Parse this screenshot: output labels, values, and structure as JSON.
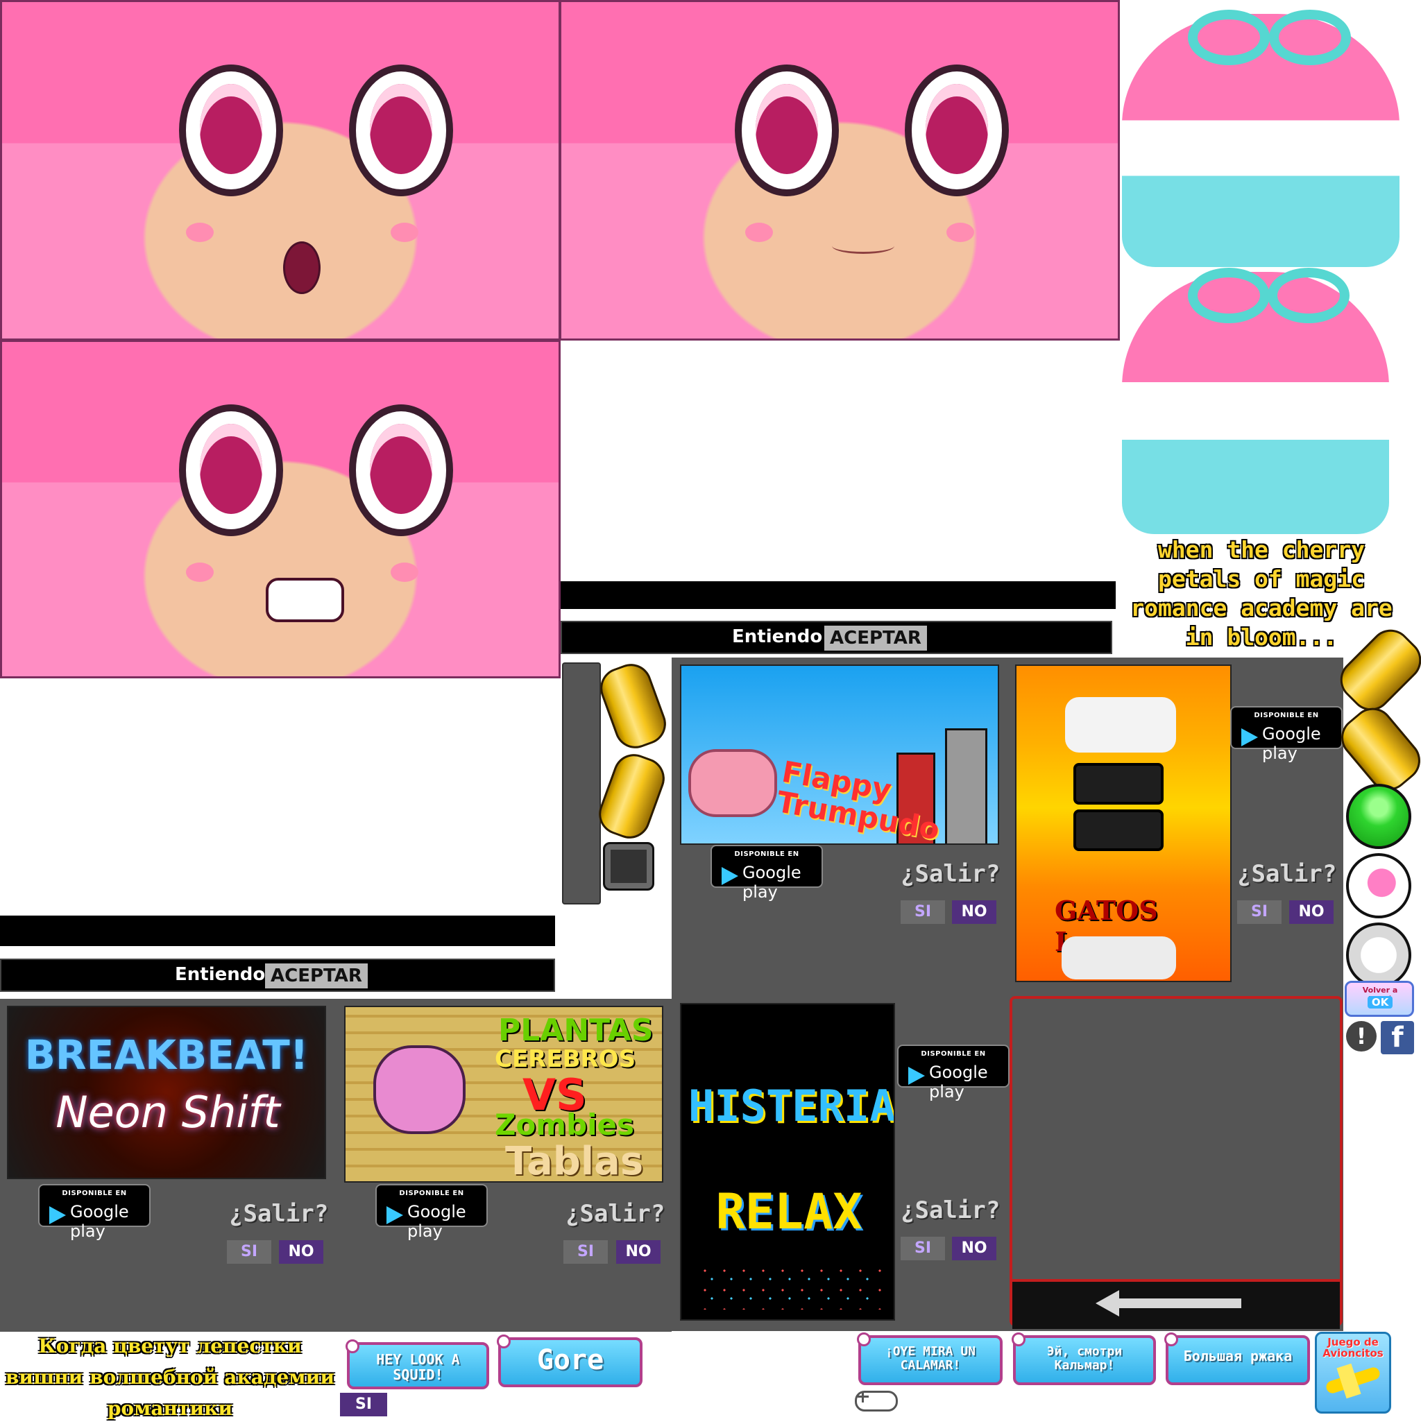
{
  "dialogs": {
    "top": {
      "understand": "Entiendo",
      "accept": "ACEPTAR"
    },
    "left": {
      "understand": "Entiendo",
      "accept": "ACEPTAR"
    }
  },
  "caption_en": "when the cherry petals of magic romance academy are in bloom...",
  "caption_ru": "Когда цветут лепестки вишни волшебной академии романтики",
  "games": {
    "flappy": {
      "title": "Flappy Trumpudo",
      "store_top": "DISPONIBLE EN",
      "store_bottom": "Google play",
      "prompt": "¿Salir?",
      "yes": "SI",
      "no": "NO"
    },
    "gatos": {
      "title": "GATOS Locos",
      "store_top": "DISPONIBLE EN",
      "store_bottom": "Google play",
      "prompt": "¿Salir?",
      "yes": "SI",
      "no": "NO"
    },
    "breakbeat": {
      "title_top": "BREAKBEAT!",
      "title_bottom": "Neon Shift",
      "store_top": "DISPONIBLE EN",
      "store_bottom": "Google play",
      "prompt": "¿Salir?",
      "yes": "SI",
      "no": "NO"
    },
    "plantas": {
      "title_top": "PLANTAS",
      "title_middle": "CEREBROS",
      "vs": "VS",
      "title_bottom": "Zombies",
      "subtitle": "Tablas",
      "store_top": "DISPONIBLE EN",
      "store_bottom": "Google play",
      "prompt": "¿Salir?",
      "yes": "SI",
      "no": "NO"
    },
    "histeria": {
      "title_top": "HISTERIA",
      "title_bottom": "RELAX",
      "store_top": "DISPONIBLE EN",
      "store_bottom": "Google play",
      "prompt": "¿Salir?",
      "yes": "SI",
      "no": "NO"
    }
  },
  "bottom_buttons": {
    "hey_look": "HEY LOOK A SQUID!",
    "gore": "Gore",
    "oye_mira": "¡OYE MIRA UN CALAMAR!",
    "russian_1": "Эй, смотри Кальмар!",
    "russian_2": "Большая ржака",
    "si": "SI",
    "corner": "Juego de Avioncitos"
  },
  "side": {
    "volver": "Volver a Menú",
    "ok": "OK",
    "exclaim": "!"
  },
  "colors": {
    "accent_pink": "#ff6fb1",
    "panel_gray": "#565656",
    "button_purple": "#512f7e",
    "gold": "#f6c51b",
    "green_power": "#2fd42f"
  }
}
